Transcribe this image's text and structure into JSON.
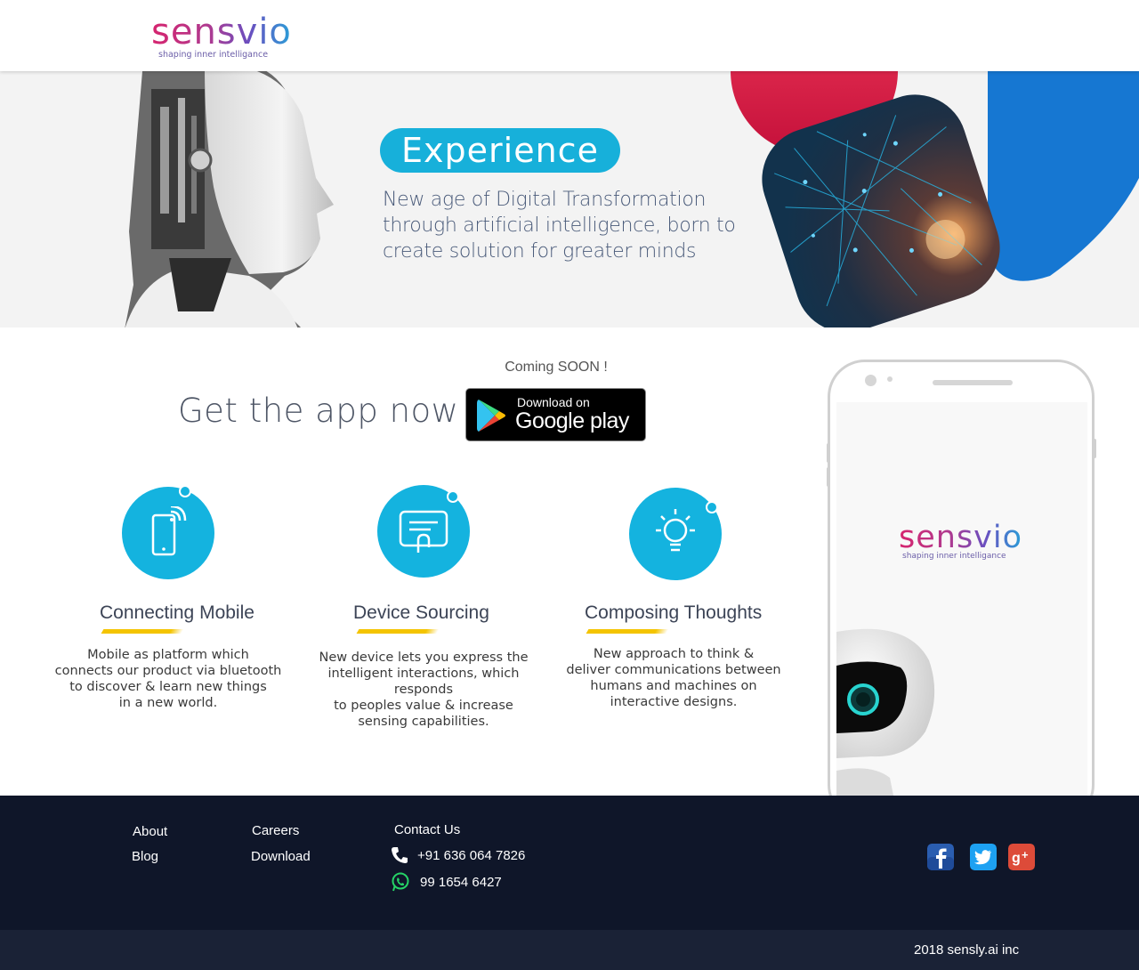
{
  "brand": {
    "name": "sensvio",
    "tagline": "shaping inner intelligance"
  },
  "hero": {
    "badge": "Experience",
    "description": "New age of Digital Transformation through artificial intelligence, born to create solution for greater minds"
  },
  "app": {
    "coming_soon": "Coming SOON !",
    "headline": "Get the app now",
    "store_small": "Download on",
    "store_big": "Google play"
  },
  "features": [
    {
      "title": "Connecting Mobile",
      "icon": "mobile-signal-icon",
      "text_lines": [
        "Mobile as platform which",
        "connects our product via bluetooth",
        "to discover & learn new things",
        "in a new world."
      ]
    },
    {
      "title": "Device Sourcing",
      "icon": "touch-screen-icon",
      "text_lines": [
        "New device lets you express the",
        "intelligent interactions, which responds",
        "to peoples value & increase",
        "sensing capabilities."
      ]
    },
    {
      "title": "Composing Thoughts",
      "icon": "lightbulb-icon",
      "text_lines": [
        "New approach to think &",
        "deliver communications between",
        "humans and machines on",
        "interactive designs."
      ]
    }
  ],
  "phone": {
    "brand": "sensvio",
    "tagline": "shaping inner intelligance"
  },
  "footer": {
    "links": [
      "About",
      "Blog",
      "Careers",
      "Download"
    ],
    "contact_title": "Contact Us",
    "phone_number": "+91 636 064 7826",
    "whatsapp_number": "99 1654 6427",
    "social": [
      "facebook-icon",
      "twitter-icon",
      "google-plus-icon"
    ],
    "copyright": "2018 sensly.ai inc"
  },
  "colors": {
    "accent": "#14b3df",
    "footer_bg": "#0f1629",
    "underline": "#f4c400"
  }
}
